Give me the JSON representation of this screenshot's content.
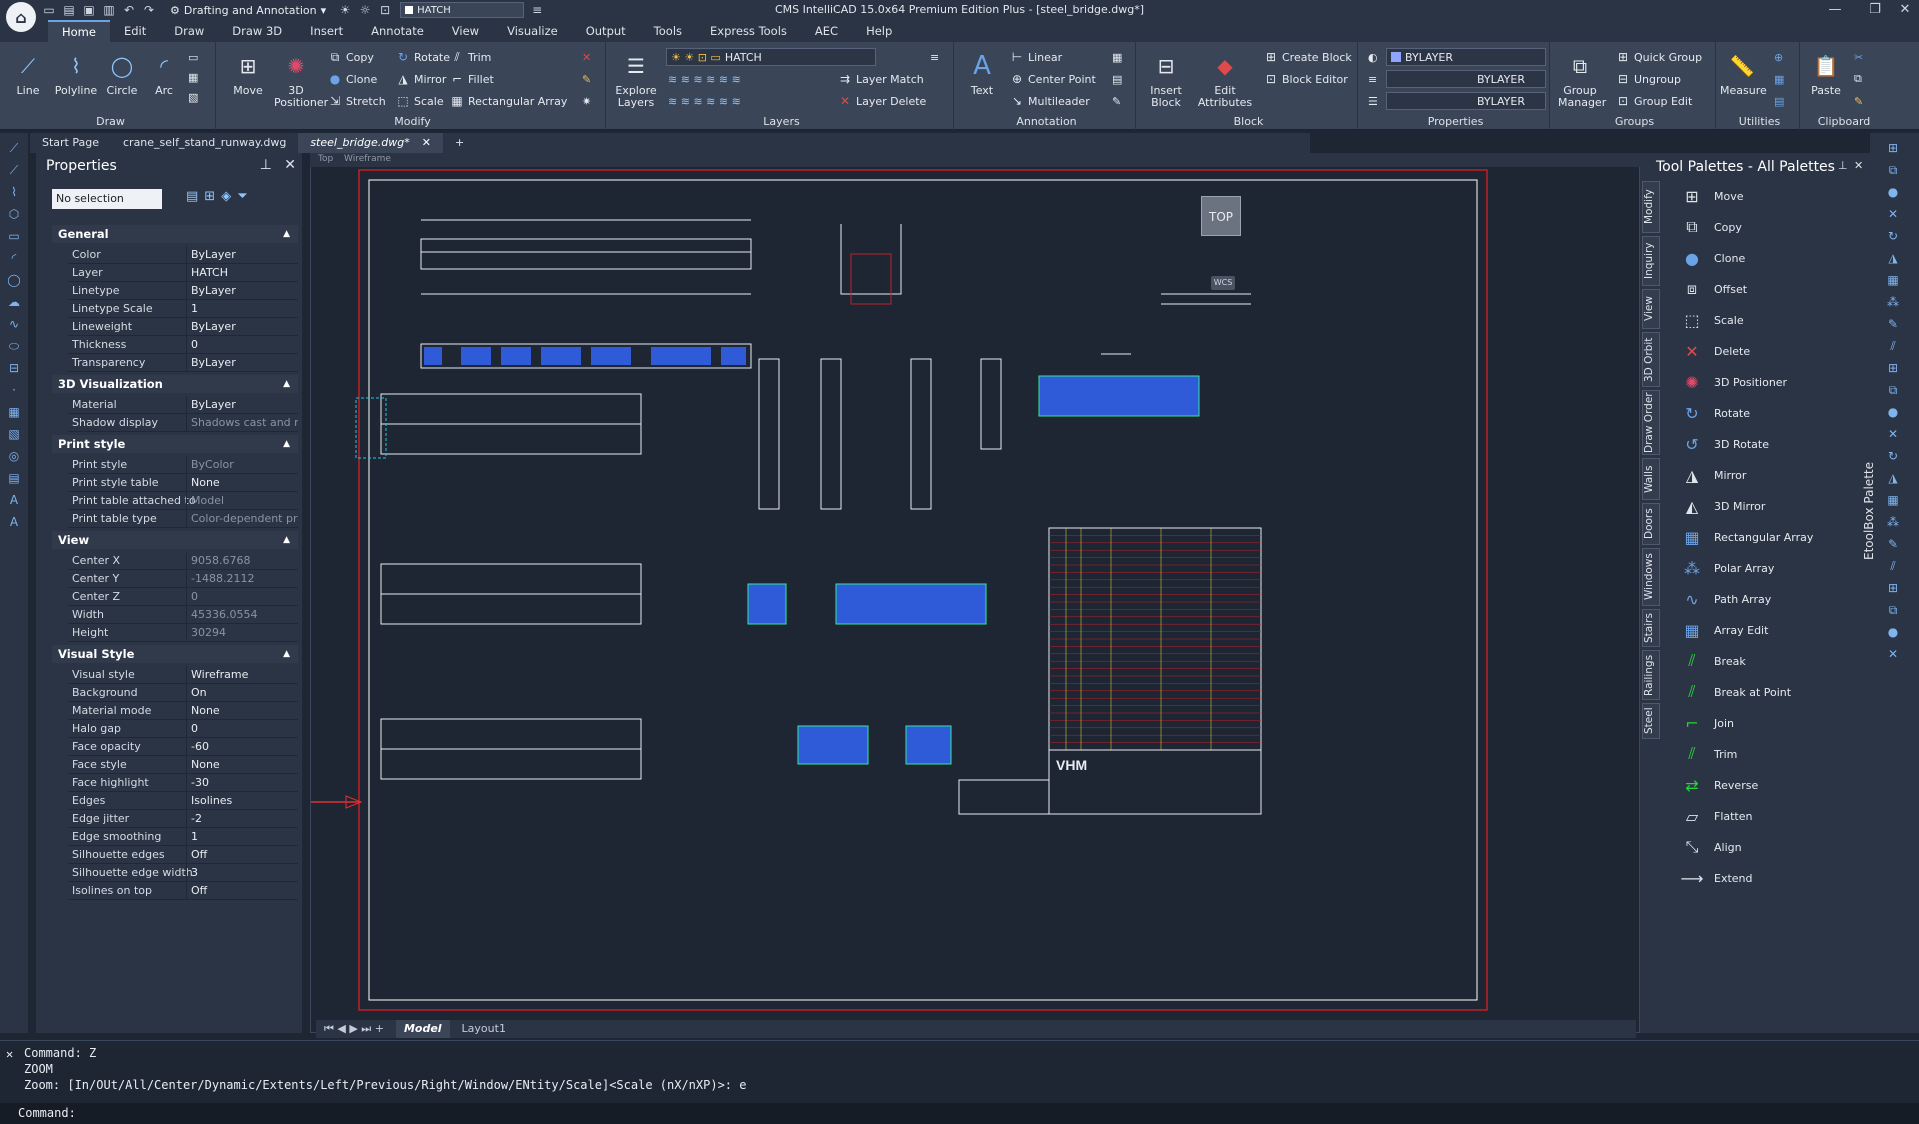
{
  "titlebar": {
    "title": "CMS IntelliCAD 15.0x64 Premium Edition Plus - [steel_bridge.dwg*]",
    "workspace": "Drafting and Annotation",
    "layer": "HATCH"
  },
  "menu": [
    "Home",
    "Edit",
    "Draw",
    "Draw 3D",
    "Insert",
    "Annotate",
    "View",
    "Visualize",
    "Output",
    "Tools",
    "Express Tools",
    "AEC",
    "Help"
  ],
  "ribbon": {
    "draw": {
      "title": "Draw",
      "line": "Line",
      "polyline": "Polyline",
      "circle": "Circle",
      "arc": "Arc"
    },
    "modify": {
      "title": "Modify",
      "move": "Move",
      "positioner": "3D Positioner",
      "copy": "Copy",
      "clone": "Clone",
      "stretch": "Stretch",
      "rotate": "Rotate",
      "mirror": "Mirror",
      "scale": "Scale",
      "trim": "Trim",
      "fillet": "Fillet",
      "rect_array": "Rectangular Array"
    },
    "layers": {
      "title": "Layers",
      "explore": "Explore Layers",
      "layer": "HATCH",
      "layer_match": "Layer Match",
      "layer_delete": "Layer Delete"
    },
    "annotation": {
      "title": "Annotation",
      "text": "Text",
      "linear": "Linear",
      "center_point": "Center Point",
      "multileader": "Multileader"
    },
    "block": {
      "title": "Block",
      "insert": "Insert Block",
      "edit_attr": "Edit Attributes",
      "create": "Create Block",
      "editor": "Block Editor"
    },
    "properties": {
      "title": "Properties",
      "color": "BYLAYER",
      "linetype": "BYLAYER",
      "lineweight": "BYLAYER"
    },
    "groups": {
      "title": "Groups",
      "manager": "Group Manager",
      "quick": "Quick Group",
      "ungroup": "Ungroup",
      "edit": "Group Edit"
    },
    "utilities": {
      "title": "Utilities",
      "measure": "Measure"
    },
    "clipboard": {
      "title": "Clipboard",
      "paste": "Paste"
    }
  },
  "doctabs": [
    "Start Page",
    "crane_self_stand_runway.dwg",
    "steel_bridge.dwg*"
  ],
  "properties": {
    "title": "Properties",
    "selection": "No selection",
    "sections": {
      "general": {
        "title": "General",
        "rows": [
          [
            "Color",
            "ByLayer"
          ],
          [
            "Layer",
            "HATCH"
          ],
          [
            "Linetype",
            "ByLayer"
          ],
          [
            "Linetype Scale",
            "1"
          ],
          [
            "Lineweight",
            "ByLayer"
          ],
          [
            "Thickness",
            "0"
          ],
          [
            "Transparency",
            "ByLayer"
          ]
        ]
      },
      "viz3d": {
        "title": "3D Visualization",
        "rows": [
          [
            "Material",
            "ByLayer"
          ],
          [
            "Shadow display",
            "Shadows cast and re..."
          ]
        ]
      },
      "print": {
        "title": "Print style",
        "rows": [
          [
            "Print style",
            "ByColor"
          ],
          [
            "Print style table",
            "None"
          ],
          [
            "Print table attached to",
            "Model"
          ],
          [
            "Print table type",
            "Color-dependent print..."
          ]
        ]
      },
      "view": {
        "title": "View",
        "rows": [
          [
            "Center X",
            "9058.6768"
          ],
          [
            "Center Y",
            "-1488.2112"
          ],
          [
            "Center Z",
            "0"
          ],
          [
            "Width",
            "45336.0554"
          ],
          [
            "Height",
            "30294"
          ]
        ]
      },
      "visual": {
        "title": "Visual Style",
        "rows": [
          [
            "Visual style",
            "Wireframe"
          ],
          [
            "Background",
            "On"
          ],
          [
            "Material mode",
            "None"
          ],
          [
            "Halo gap",
            "0"
          ],
          [
            "Face opacity",
            "-60"
          ],
          [
            "Face style",
            "None"
          ],
          [
            "Face highlight",
            "-30"
          ],
          [
            "Edges",
            "Isolines"
          ],
          [
            "Edge jitter",
            "-2"
          ],
          [
            "Edge smoothing",
            "1"
          ],
          [
            "Silhouette edges",
            "Off"
          ],
          [
            "Silhouette edge width",
            "3"
          ],
          [
            "Isolines on top",
            "Off"
          ]
        ]
      }
    }
  },
  "viewport": {
    "view": "Top",
    "style": "Wireframe",
    "cube": "TOP",
    "wcs": "WCS"
  },
  "layout_tabs": [
    "Model",
    "Layout1"
  ],
  "palette": {
    "title": "Tool Palettes - All Palettes",
    "side_title": "EtoolBox Palette",
    "tabs": [
      "Modify",
      "Inquiry",
      "View",
      "3D Orbit",
      "Draw Order",
      "Walls",
      "Doors",
      "Windows",
      "Stairs",
      "Railings",
      "Steel"
    ],
    "items": [
      "Move",
      "Copy",
      "Clone",
      "Offset",
      "Scale",
      "Delete",
      "3D Positioner",
      "Rotate",
      "3D Rotate",
      "Mirror",
      "3D Mirror",
      "Rectangular Array",
      "Polar Array",
      "Path Array",
      "Array Edit",
      "Break",
      "Break at Point",
      "Join",
      "Trim",
      "Reverse",
      "Flatten",
      "Align",
      "Extend"
    ]
  },
  "command": {
    "l1": "Command: Z",
    "l2": "ZOOM",
    "l3": "Zoom:  [In/OUt/All/Center/Dynamic/Extents/Left/Previous/Right/Window/ENtity/Scale]<Scale (nX/nXP)>: e",
    "prompt": "Command:"
  }
}
